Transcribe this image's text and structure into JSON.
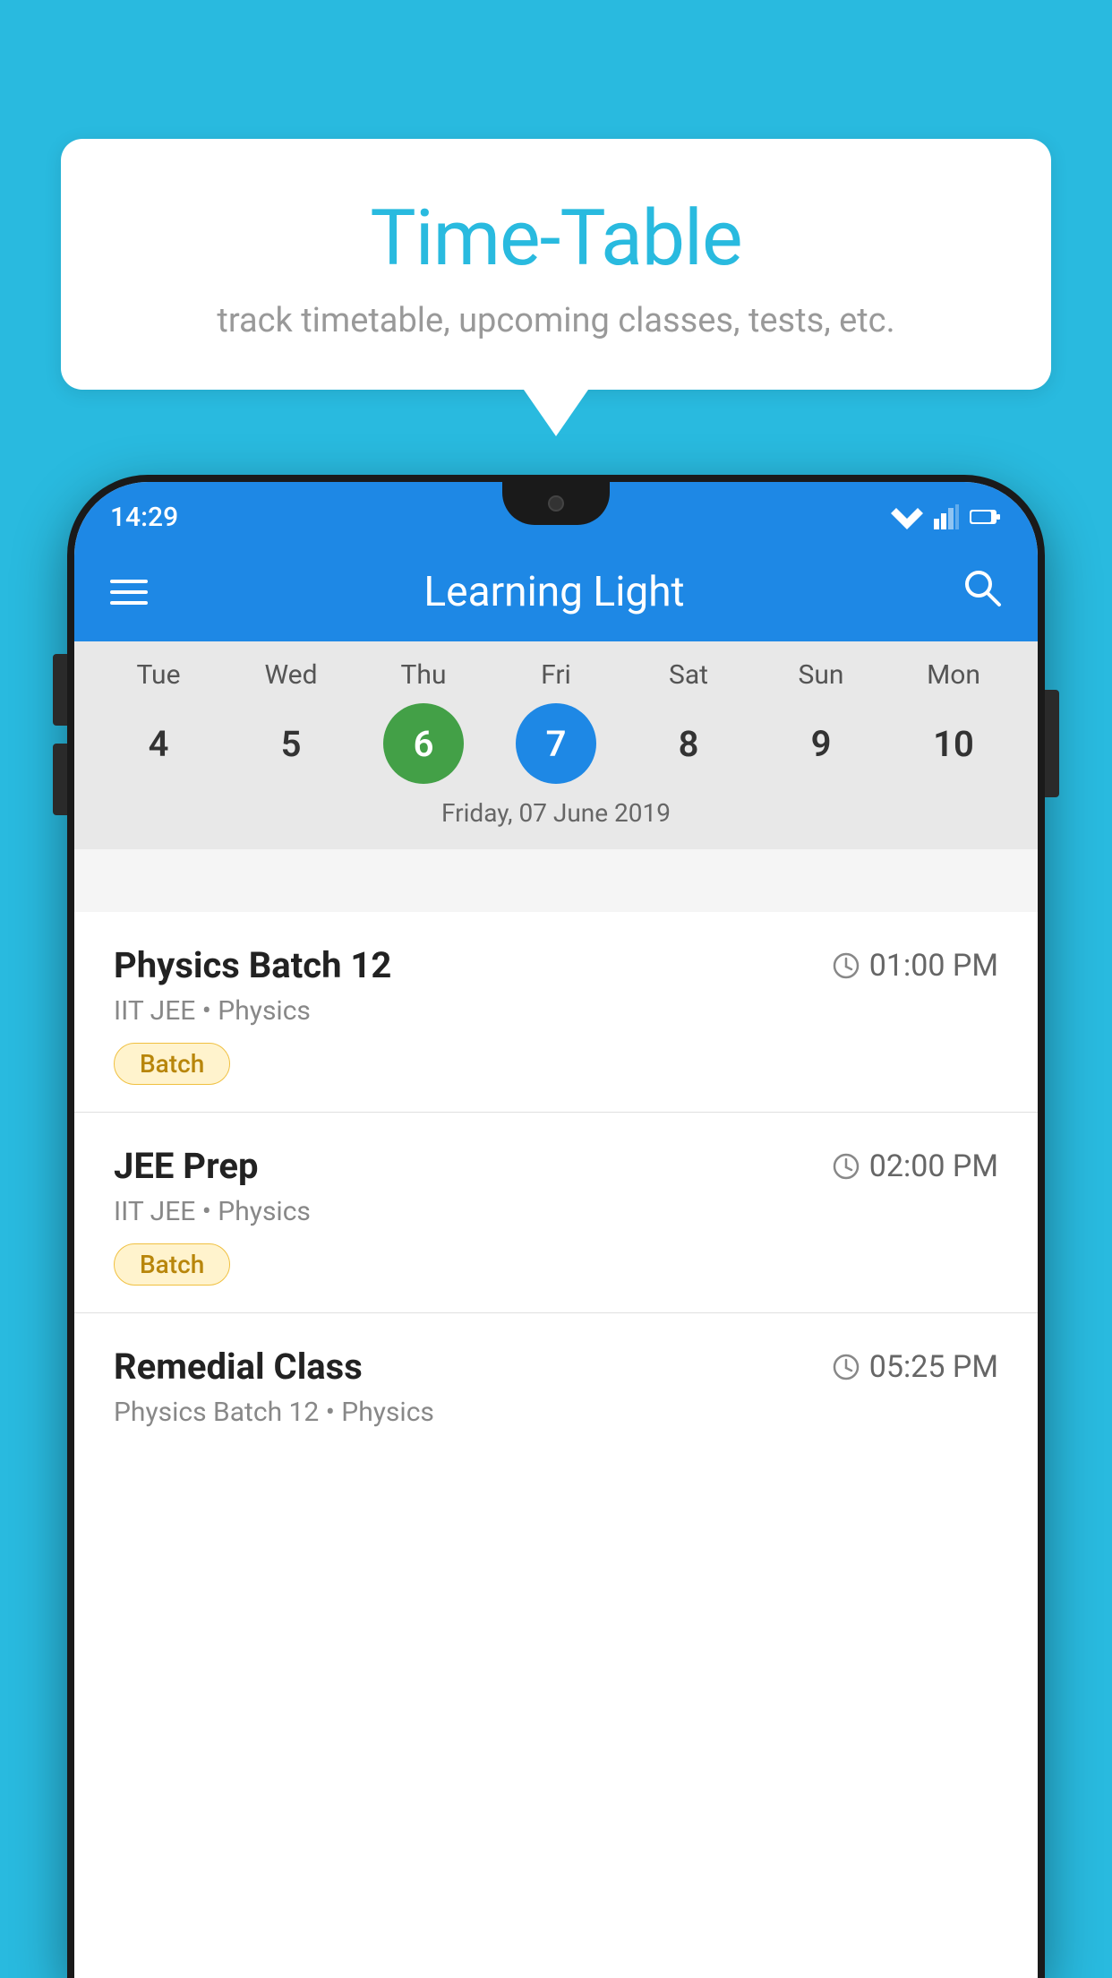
{
  "background_color": "#29BADF",
  "speech_bubble": {
    "title": "Time-Table",
    "subtitle": "track timetable, upcoming classes, tests, etc."
  },
  "status_bar": {
    "time": "14:29"
  },
  "app_bar": {
    "title": "Learning Light"
  },
  "calendar": {
    "days": [
      {
        "label": "Tue",
        "num": "4",
        "state": "normal"
      },
      {
        "label": "Wed",
        "num": "5",
        "state": "normal"
      },
      {
        "label": "Thu",
        "num": "6",
        "state": "today"
      },
      {
        "label": "Fri",
        "num": "7",
        "state": "selected"
      },
      {
        "label": "Sat",
        "num": "8",
        "state": "normal"
      },
      {
        "label": "Sun",
        "num": "9",
        "state": "normal"
      },
      {
        "label": "Mon",
        "num": "10",
        "state": "normal"
      }
    ],
    "selected_date": "Friday, 07 June 2019"
  },
  "classes": [
    {
      "name": "Physics Batch 12",
      "time": "01:00 PM",
      "details": "IIT JEE • Physics",
      "badge": "Batch"
    },
    {
      "name": "JEE Prep",
      "time": "02:00 PM",
      "details": "IIT JEE • Physics",
      "badge": "Batch"
    },
    {
      "name": "Remedial Class",
      "time": "05:25 PM",
      "details": "Physics Batch 12 • Physics",
      "badge": null
    }
  ]
}
